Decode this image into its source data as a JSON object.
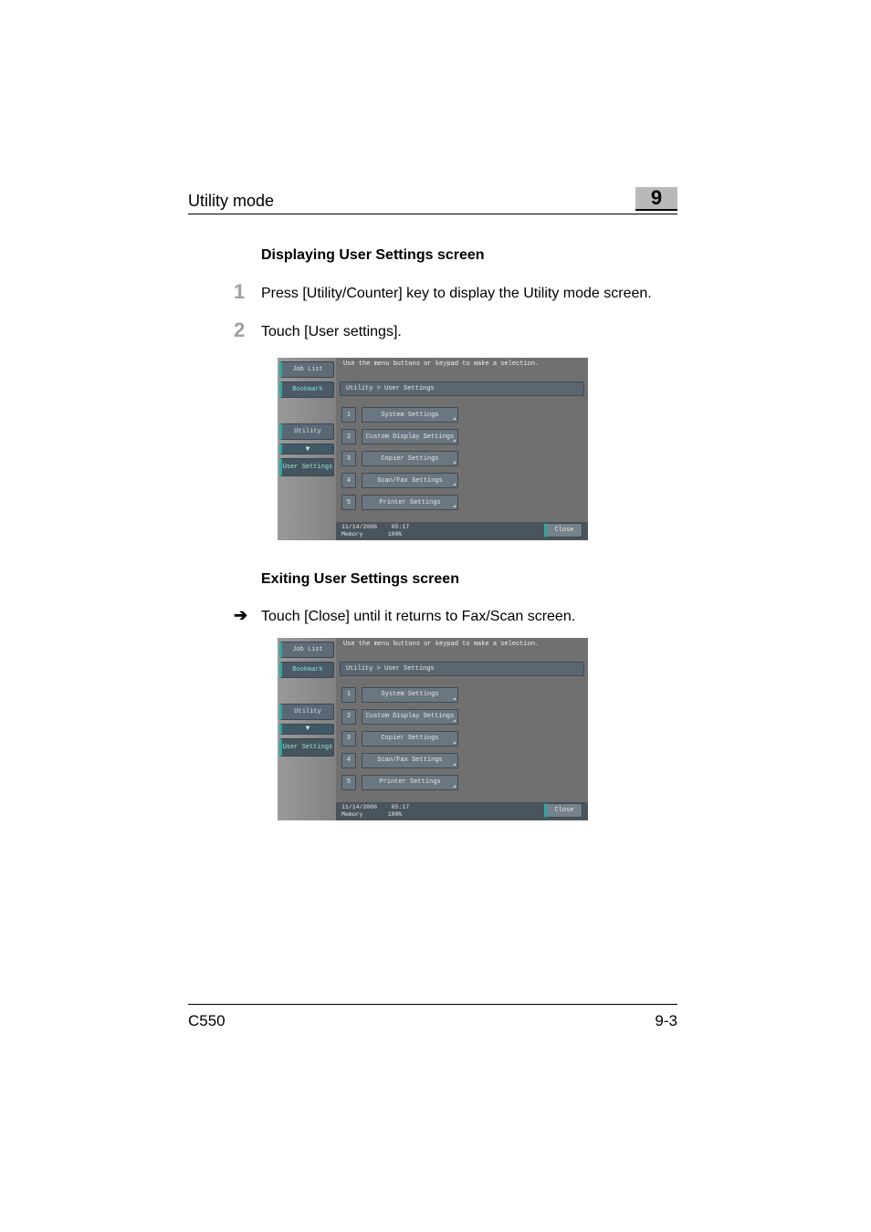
{
  "header": {
    "title": "Utility mode",
    "chapter_number": "9"
  },
  "section1": {
    "title": "Displaying User Settings screen",
    "steps": [
      {
        "num": "1",
        "text": "Press [Utility/Counter] key to display the Utility mode screen."
      },
      {
        "num": "2",
        "text": "Touch [User settings]."
      }
    ]
  },
  "section2": {
    "title": "Exiting User Settings screen",
    "arrow_text": "Touch [Close] until it returns to Fax/Scan screen."
  },
  "screenshot": {
    "left_tabs": {
      "job_list": "Job List",
      "bookmark": "Bookmark",
      "utility": "Utility",
      "arrow": "▼",
      "user_settings": "User Settings"
    },
    "message": "Use the menu buttons or keypad to make a selection.",
    "breadcrumb": "Utility > User Settings",
    "items": [
      {
        "n": "1",
        "label": "System Settings"
      },
      {
        "n": "2",
        "label": "Custom Display Settings"
      },
      {
        "n": "3",
        "label": "Copier Settings"
      },
      {
        "n": "4",
        "label": "Scan/Fax Settings"
      },
      {
        "n": "5",
        "label": "Printer Settings"
      }
    ],
    "footer": {
      "date": "11/14/2006",
      "time": "05:17",
      "memory_label": "Memory",
      "memory_value": "100%"
    },
    "close": "Close"
  },
  "footer": {
    "model": "C550",
    "page": "9-3"
  }
}
